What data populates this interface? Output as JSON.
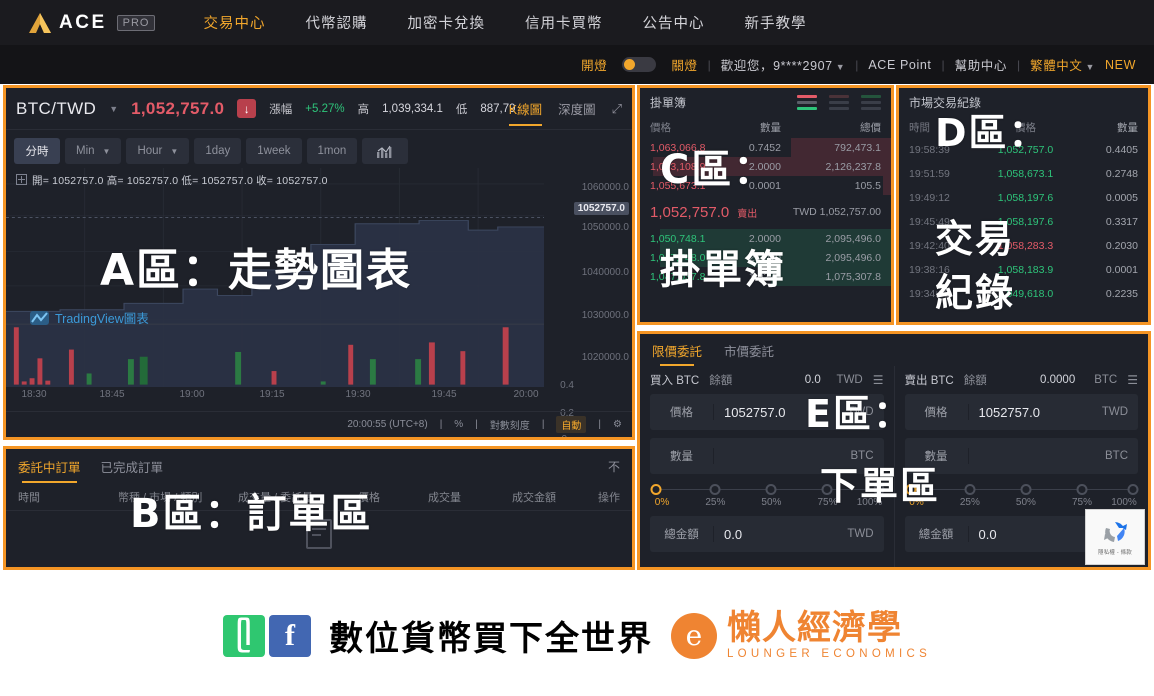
{
  "topnav": {
    "brand_text": "ACE",
    "brand_badge": "PRO",
    "links": [
      {
        "label": "交易中心",
        "active": true
      },
      {
        "label": "代幣認購",
        "active": false
      },
      {
        "label": "加密卡兌換",
        "active": false
      },
      {
        "label": "信用卡買幣",
        "active": false
      },
      {
        "label": "公告中心",
        "active": false
      },
      {
        "label": "新手教學",
        "active": false
      }
    ]
  },
  "subnav": {
    "light_on": "開燈",
    "light_off": "關燈",
    "welcome": "歡迎您，9****2907",
    "ace_point": "ACE Point",
    "help": "幫助中心",
    "lang": "繁體中文",
    "new": "NEW"
  },
  "chart": {
    "symbol": "BTC/TWD",
    "price": "1,052,757.0",
    "direction_icon": "↓",
    "change_label": "漲幅",
    "change_value": "+5.27%",
    "high_label": "高",
    "high_value": "1,039,334.1",
    "low_label": "低",
    "low_value": "887,79",
    "tab_kline": "K線圖",
    "tab_depth": "深度圖",
    "timeframes": [
      "分時",
      "Min",
      "Hour",
      "1day",
      "1week",
      "1mon"
    ],
    "ohlc": "開= 1052757.0  高= 1052757.0  低= 1052757.0  收= 1052757.0",
    "tradingview": "TradingView圖表",
    "y_ticks": [
      "1060000.0",
      "1050000.0",
      "1040000.0",
      "1030000.0",
      "1020000.0"
    ],
    "y_current": "1052757.0",
    "vol_ticks": [
      "0.4",
      "0.2",
      "0"
    ],
    "x_ticks": [
      "18:30",
      "18:45",
      "19:00",
      "19:15",
      "19:30",
      "19:45",
      "20:00"
    ],
    "clock": "20:00:55 (UTC+8)",
    "percent": "%",
    "log_scale": "對數刻度",
    "auto": "自動"
  },
  "orders": {
    "tab_open": "委託中訂單",
    "tab_done": "已完成訂單",
    "collapse": "不",
    "columns": [
      "時間",
      "幣種 / 市場 / 類別",
      "成交量 / 委託量",
      "價格",
      "成交量",
      "成交金額",
      "操作"
    ]
  },
  "orderbook": {
    "title": "掛單簿",
    "columns": [
      "價格",
      "數量",
      "總價"
    ],
    "asks": [
      {
        "price": "1,063,066.8",
        "amount": "0.7452",
        "total": "792,473.1",
        "fill": 40
      },
      {
        "price": "1,063,108.9",
        "amount": "2.0000",
        "total": "2,126,237.8",
        "fill": 95
      },
      {
        "price": "1,055,673.1",
        "amount": "0.0001",
        "total": "105.5",
        "fill": 3
      }
    ],
    "mid_price": "1,052,757.0",
    "mid_sub": "賣出",
    "mid_right": "TWD 1,052,757.00",
    "bids": [
      {
        "price": "1,050,748.1",
        "amount": "2.0000",
        "total": "2,095,496.0",
        "fill": 92
      },
      {
        "price": "1,047,748.0",
        "amount": "2.0000",
        "total": "2,095,496.0",
        "fill": 92
      },
      {
        "price": "1,047,037.8",
        "amount": "1.0270",
        "total": "1,075,307.8",
        "fill": 48
      }
    ]
  },
  "trades": {
    "title": "市場交易紀錄",
    "columns": [
      "時間",
      "價格",
      "數量"
    ],
    "rows": [
      {
        "time": "19:58:39",
        "price": "1,052,757.0",
        "amount": "0.4405",
        "dir": "up"
      },
      {
        "time": "19:51:59",
        "price": "1,058,673.1",
        "amount": "0.2748",
        "dir": "up"
      },
      {
        "time": "19:49:12",
        "price": "1,058,197.6",
        "amount": "0.0005",
        "dir": "up"
      },
      {
        "time": "19:45:49",
        "price": "1,058,197.6",
        "amount": "0.3317",
        "dir": "up"
      },
      {
        "time": "19:42:40",
        "price": "1,058,283.3",
        "amount": "0.2030",
        "dir": "down"
      },
      {
        "time": "19:38:16",
        "price": "1,058,183.9",
        "amount": "0.0001",
        "dir": "up"
      },
      {
        "time": "19:34:39",
        "price": "1,049,618.0",
        "amount": "0.2235",
        "dir": "up"
      }
    ]
  },
  "orderform": {
    "tab_limit": "限價委託",
    "tab_market": "市價委託",
    "buy": {
      "action": "買入 BTC",
      "balance_label": "餘額",
      "balance_value": "0.0",
      "balance_cur": "TWD",
      "price_label": "價格",
      "price_value": "1052757.0",
      "price_cur": "TWD",
      "amount_label": "數量",
      "amount_value": "",
      "amount_cur": "BTC",
      "total_label": "總金額",
      "total_value": "0.0",
      "total_cur": "TWD"
    },
    "sell": {
      "action": "賣出 BTC",
      "balance_label": "餘額",
      "balance_value": "0.0000",
      "balance_cur": "BTC",
      "price_label": "價格",
      "price_value": "1052757.0",
      "price_cur": "TWD",
      "amount_label": "數量",
      "amount_value": "",
      "amount_cur": "BTC",
      "total_label": "總金額",
      "total_value": "0.0",
      "total_cur": ""
    },
    "slider_steps": [
      "0%",
      "25%",
      "50%",
      "75%",
      "100%"
    ]
  },
  "recaptcha": {
    "text": "隱私權 - 條款"
  },
  "annotations": {
    "a": "A區：走勢圖表",
    "b": "B區：訂單區",
    "c1": "C區：",
    "c2": "掛單簿",
    "d1": "D區：",
    "d2": "交易",
    "d3": "紀錄",
    "e1": "E區：",
    "e2": "下單區"
  },
  "footer": {
    "line_glyph": "ᥫ",
    "fb_glyph": "f",
    "slogan": "數位貨幣買下全世界",
    "le_mark": "e",
    "le_cn": "懶人經濟學",
    "le_en": "LOUNGER ECONOMICS"
  },
  "colors": {
    "accent": "#F59524",
    "gold": "#f2a72c",
    "up": "#2ec47a",
    "down": "#e35b68",
    "panel": "#1e2129",
    "nav": "#1b1b1f"
  }
}
